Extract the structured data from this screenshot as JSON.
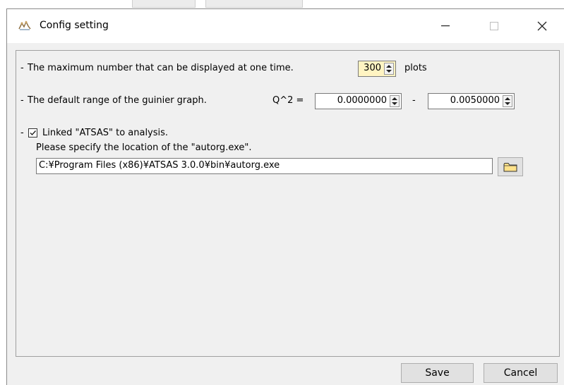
{
  "window": {
    "title": "Config setting",
    "icon": "app-icon",
    "minimize_glyph": "—",
    "maximize_glyph": "☐",
    "close_glyph": "✕"
  },
  "settings": {
    "max_display": {
      "dash": "-",
      "label": "The maximum number that can be displayed at one time.",
      "value": "300",
      "unit": "plots"
    },
    "guinier_range": {
      "dash": "-",
      "label": "The default range of the guinier graph.",
      "q_label": "Q^2 =",
      "min_value": "0.0000000",
      "separator": "-",
      "max_value": "0.0050000"
    },
    "atsas": {
      "dash": "-",
      "checked": true,
      "check_glyph": "✓",
      "label": "Linked \"ATSAS\" to analysis.",
      "hint": "Please specify the location of the \"autorg.exe\".",
      "path": "C:¥Program Files (x86)¥ATSAS 3.0.0¥bin¥autorg.exe",
      "folder_icon": "folder-icon"
    }
  },
  "footer": {
    "save_label": "Save",
    "cancel_label": "Cancel"
  },
  "colors": {
    "window_bg": "#f0f0f0",
    "titlebar_bg": "#ffffff",
    "highlight_field": "#fff4c2",
    "button_bg": "#e1e1e1",
    "border": "#a0a0a0"
  }
}
